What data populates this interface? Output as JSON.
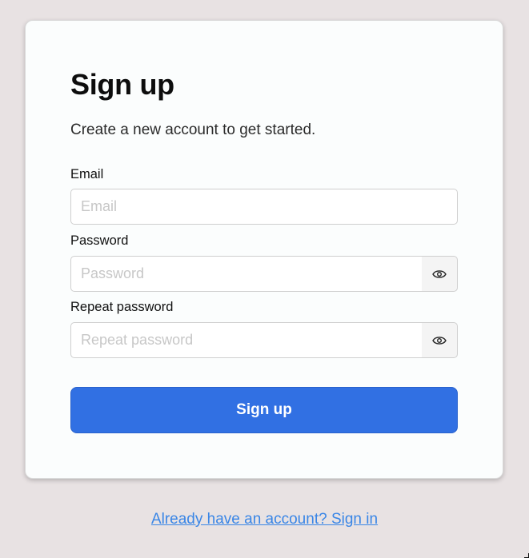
{
  "form": {
    "title": "Sign up",
    "subtitle": "Create a new account to get started.",
    "email": {
      "label": "Email",
      "placeholder": "Email",
      "value": ""
    },
    "password": {
      "label": "Password",
      "placeholder": "Password",
      "value": "",
      "toggle_icon": "eye-icon"
    },
    "repeat_password": {
      "label": "Repeat password",
      "placeholder": "Repeat password",
      "value": "",
      "toggle_icon": "eye-icon"
    },
    "submit_label": "Sign up"
  },
  "footer": {
    "signin_link": "Already have an account? Sign in"
  },
  "colors": {
    "background": "#e8e2e3",
    "card": "#fbfdfd",
    "primary": "#3170e3",
    "link": "#3a86e6"
  }
}
